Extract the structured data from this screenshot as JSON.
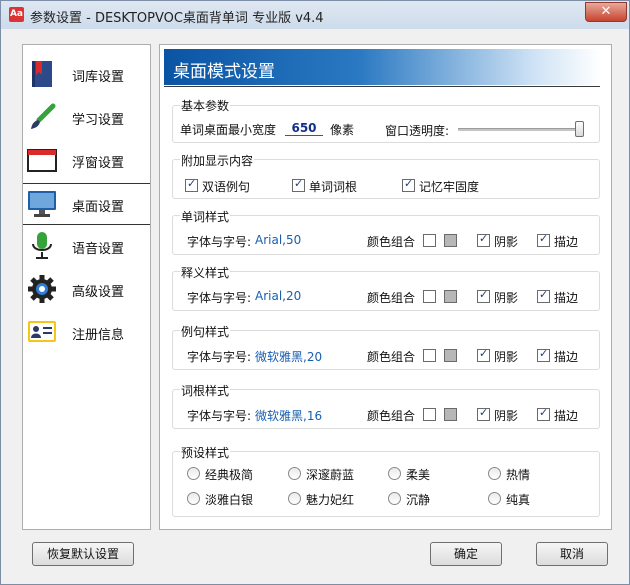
{
  "window": {
    "title": "参数设置 - DESKTOPVOC桌面背单词 专业版 v4.4",
    "app_icon_text": "Aa",
    "close_symbol": "✕"
  },
  "sidebar": {
    "items": [
      {
        "label": "词库设置",
        "icon": "book-icon"
      },
      {
        "label": "学习设置",
        "icon": "brush-icon"
      },
      {
        "label": "浮窗设置",
        "icon": "window-icon"
      },
      {
        "label": "桌面设置",
        "icon": "monitor-icon",
        "active": true
      },
      {
        "label": "语音设置",
        "icon": "microphone-icon"
      },
      {
        "label": "高级设置",
        "icon": "gear-icon"
      },
      {
        "label": "注册信息",
        "icon": "id-card-icon"
      }
    ]
  },
  "panel": {
    "banner_title": "桌面模式设置",
    "basic": {
      "title": "基本参数",
      "min_width_label": "单词桌面最小宽度",
      "min_width_value": "650",
      "min_width_unit": "像素",
      "opacity_label": "窗口透明度:",
      "opacity_level": 1.0
    },
    "extra": {
      "title": "附加显示内容",
      "options": [
        {
          "label": "双语例句",
          "checked": true
        },
        {
          "label": "单词词根",
          "checked": true
        },
        {
          "label": "记忆牢固度",
          "checked": true
        }
      ]
    },
    "font_label": "字体与字号:",
    "color_label": "颜色组合",
    "shadow_label": "阴影",
    "outline_label": "描边",
    "styles": [
      {
        "title": "单词样式",
        "font": "Arial,50"
      },
      {
        "title": "释义样式",
        "font": "Arial,20"
      },
      {
        "title": "例句样式",
        "font": "微软雅黑,20"
      },
      {
        "title": "词根样式",
        "font": "微软雅黑,16"
      }
    ],
    "presets": {
      "title": "预设样式",
      "options": [
        "经典极简",
        "深邃蔚蓝",
        "柔美",
        "热情",
        "淡雅白银",
        "魅力妃红",
        "沉静",
        "纯真"
      ]
    }
  },
  "buttons": {
    "restore": "恢复默认设置",
    "ok": "确定",
    "cancel": "取消"
  },
  "colors": {
    "banner_start": "#0a54a4",
    "link_blue": "#1a5eb0",
    "swatch_gray": "#b7b7b7"
  }
}
